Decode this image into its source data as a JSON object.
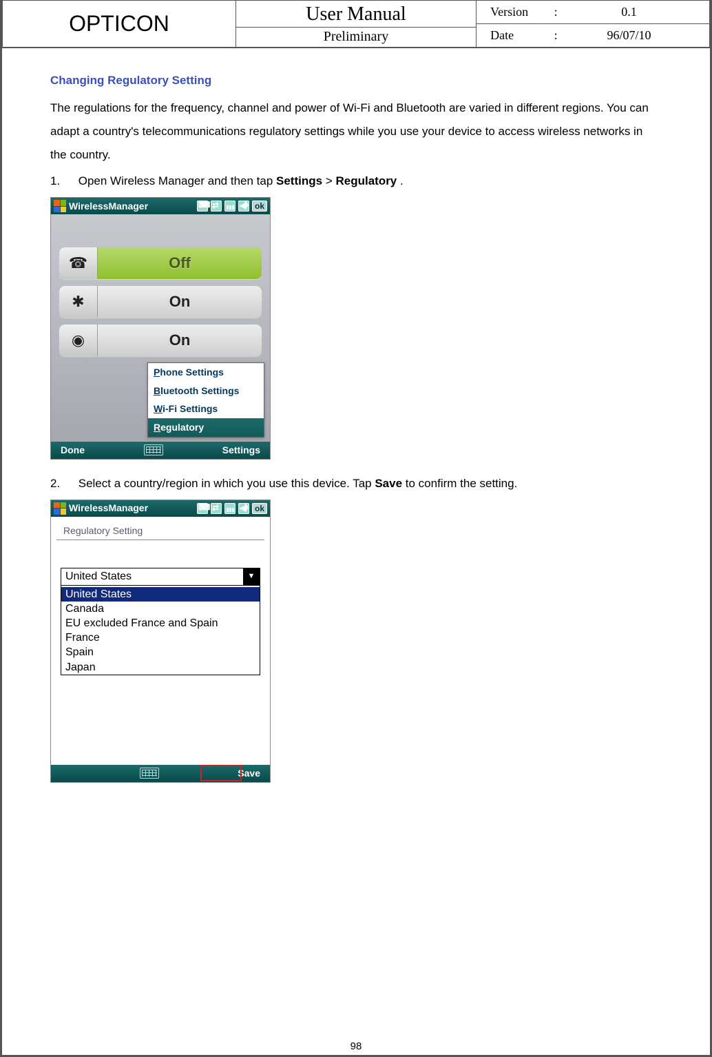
{
  "header": {
    "brand": "OPTICON",
    "title": "User Manual",
    "subtitle": "Preliminary",
    "meta": {
      "version_label": "Version",
      "version_value": "0.1",
      "date_label": "Date",
      "date_value": "96/07/10",
      "colon": ":"
    }
  },
  "section": {
    "title": "Changing Regulatory Setting",
    "paragraph": "The regulations for the frequency, channel and power of Wi-Fi and Bluetooth are varied in different regions. You can adapt a country's telecommunications regulatory settings while you use your device to access wireless networks in the country.",
    "step1": {
      "num": "1.",
      "lead": "Open Wireless Manager and then tap ",
      "bold1": "Settings",
      "mid": " > ",
      "bold2": "Regulatory",
      "tail": "."
    },
    "step2": {
      "num": "2.",
      "lead": "Select a country/region in which you use this device. Tap ",
      "bold1": "Save",
      "tail": " to confirm the setting."
    }
  },
  "shot1": {
    "titlebar": "WirelessManager",
    "ok": "ok",
    "toggles": [
      {
        "icon": "☎",
        "state": "Off",
        "cls": "off"
      },
      {
        "icon": "✱",
        "state": "On",
        "cls": "on"
      },
      {
        "icon": "◉",
        "state": "On",
        "cls": "on"
      }
    ],
    "popup": {
      "items": [
        {
          "u": "P",
          "rest": "hone Settings"
        },
        {
          "u": "B",
          "rest": "luetooth Settings"
        },
        {
          "u": "W",
          "rest": "i-Fi Settings"
        }
      ],
      "selected": {
        "u": "R",
        "rest": "egulatory"
      }
    },
    "bottombar": {
      "left": "Done",
      "right": "Settings"
    }
  },
  "shot2": {
    "titlebar": "WirelessManager",
    "ok": "ok",
    "reg_title": "Regulatory Setting",
    "selected": "United States",
    "options": [
      "",
      "United States",
      "Canada",
      "EU excluded France and Spain",
      "France",
      "Spain",
      "Japan"
    ],
    "bottombar_right": "Save"
  },
  "page_number": "98"
}
